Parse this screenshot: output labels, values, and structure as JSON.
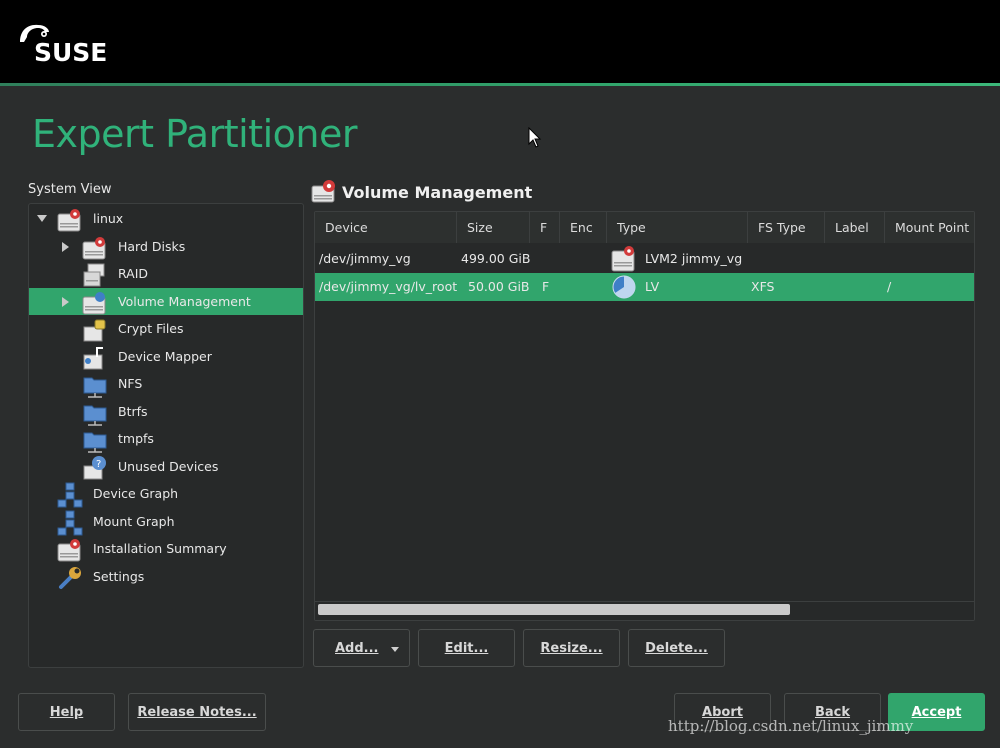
{
  "brand": {
    "logo_text": "SUSE",
    "accent": "#31a56c"
  },
  "page": {
    "title": "Expert Partitioner"
  },
  "system_view": {
    "label": "System View",
    "items": [
      {
        "label": "linux",
        "icon": "hard-disk-icon",
        "expander": "open"
      },
      {
        "label": "Hard Disks",
        "icon": "hard-disk-icon",
        "expander": "closed"
      },
      {
        "label": "RAID",
        "icon": "raid-icon",
        "expander": ""
      },
      {
        "label": "Volume Management",
        "icon": "volume-management-icon",
        "expander": "closed",
        "selected": true
      },
      {
        "label": "Crypt Files",
        "icon": "crypt-file-icon",
        "expander": ""
      },
      {
        "label": "Device Mapper",
        "icon": "device-mapper-icon",
        "expander": ""
      },
      {
        "label": "NFS",
        "icon": "folder-network-icon",
        "expander": ""
      },
      {
        "label": "Btrfs",
        "icon": "folder-network-icon",
        "expander": ""
      },
      {
        "label": "tmpfs",
        "icon": "folder-network-icon",
        "expander": ""
      },
      {
        "label": "Unused Devices",
        "icon": "unused-devices-icon",
        "expander": ""
      },
      {
        "label": "Device Graph",
        "icon": "graph-icon",
        "expander": ""
      },
      {
        "label": "Mount Graph",
        "icon": "graph-icon",
        "expander": ""
      },
      {
        "label": "Installation Summary",
        "icon": "hard-disk-icon",
        "expander": ""
      },
      {
        "label": "Settings",
        "icon": "wrench-icon",
        "expander": ""
      }
    ]
  },
  "volume_management": {
    "title": "Volume Management",
    "columns": [
      "Device",
      "Size",
      "F",
      "Enc",
      "Type",
      "FS Type",
      "Label",
      "Mount Point"
    ],
    "rows": [
      {
        "device": "/dev/jimmy_vg",
        "size": "499.00 GiB",
        "f": "",
        "enc": "",
        "type": "LVM2 jimmy_vg",
        "type_icon": "hard-disk-icon",
        "fs_type": "",
        "label": "",
        "mount": ""
      },
      {
        "device": "/dev/jimmy_vg/lv_root",
        "size": "50.00 GiB",
        "f": "F",
        "enc": "",
        "type": "LV",
        "type_icon": "logical-volume-icon",
        "fs_type": "XFS",
        "label": "",
        "mount": "/",
        "selected": true
      }
    ],
    "buttons": {
      "add": "Add...",
      "edit": "Edit...",
      "resize": "Resize...",
      "delete": "Delete..."
    }
  },
  "footer": {
    "help": "Help",
    "release_notes": "Release Notes...",
    "abort": "Abort",
    "back": "Back",
    "accept": "Accept"
  },
  "watermark": "http://blog.csdn.net/linux_jimmy"
}
